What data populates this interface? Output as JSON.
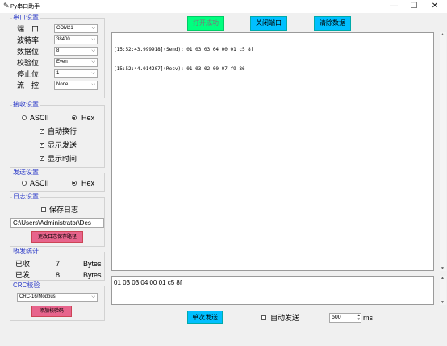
{
  "window": {
    "title": "Py串口助手",
    "icon": "feather-icon",
    "controls": {
      "minimize": "—",
      "maximize": "☐",
      "close": "✕"
    }
  },
  "serial": {
    "title": "串口设置",
    "rows": [
      {
        "label": "端　口",
        "value": "COM21"
      },
      {
        "label": "波特率",
        "value": "38400"
      },
      {
        "label": "数据位",
        "value": "8"
      },
      {
        "label": "校验位",
        "value": "Even"
      },
      {
        "label": "停止位",
        "value": "1"
      },
      {
        "label": "流　控",
        "value": "None"
      }
    ]
  },
  "receive": {
    "title": "接收设置",
    "ascii": "ASCII",
    "hex": "Hex",
    "selected": "Hex",
    "options": [
      {
        "label": "自动换行",
        "checked": true
      },
      {
        "label": "显示发送",
        "checked": true
      },
      {
        "label": "显示时间",
        "checked": true
      }
    ]
  },
  "send": {
    "title": "发送设置",
    "ascii": "ASCII",
    "hex": "Hex",
    "selected": "Hex"
  },
  "log": {
    "title": "日志设置",
    "save_label": "保存日志",
    "save_checked": false,
    "path": "C:\\Users\\Administrator\\Des",
    "change_path_button": "更改日志保存路径"
  },
  "stats": {
    "title": "收发统计",
    "rows": [
      {
        "label": "已收",
        "count": "7",
        "unit": "Bytes"
      },
      {
        "label": "已发",
        "count": "8",
        "unit": "Bytes"
      }
    ]
  },
  "crc": {
    "title": "CRC校验",
    "value": "CRC-16/Modbus",
    "add_button": "添加校验码"
  },
  "toolbar": {
    "open": "打开成功",
    "close": "关闭端口",
    "clear": "清除数据"
  },
  "receive_log": {
    "lines": [
      "[15:52:43.999918](Send): 01 03 03 04 00 01 c5 8f",
      "[15:52:44.014207](Recv): 01 03 02 00 07 f9 86"
    ]
  },
  "send_box": {
    "text": "01 03 03 04 00 01 c5 8f"
  },
  "bottom": {
    "send_once": "单次发送",
    "auto_send": "自动发送",
    "auto_checked": false,
    "interval": "500",
    "unit": "ms"
  },
  "colors": {
    "accent_label": "#2a39c7",
    "cyan_button": "#00bfff",
    "green_button": "#00ff7f",
    "pink_button": "#e7648c"
  }
}
